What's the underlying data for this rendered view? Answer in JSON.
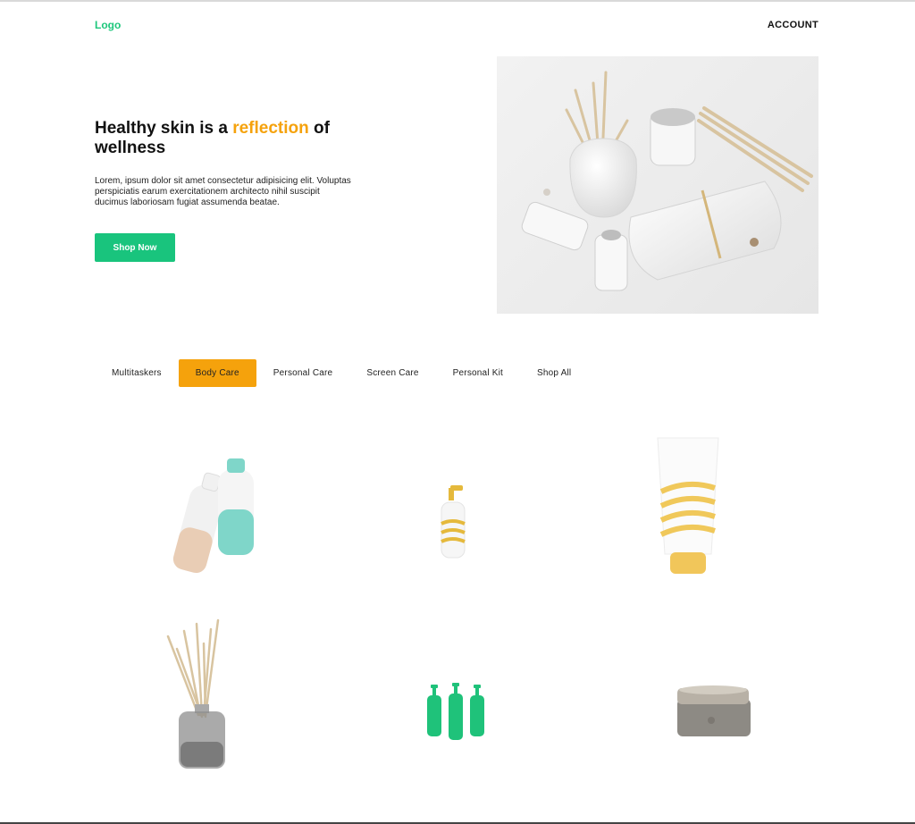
{
  "header": {
    "logo": "Logo",
    "account": "ACCOUNT"
  },
  "hero": {
    "title_before": "Healthy skin is a ",
    "title_accent": "reflection",
    "title_after": " of wellness",
    "description": "Lorem, ipsum dolor sit amet consectetur adipisicing elit. Voluptas perspiciatis earum exercitationem architecto nihil suscipit ducimus laboriosam fugiat assumenda beatae.",
    "cta_label": "Shop Now",
    "image": "spa-products-photo"
  },
  "tabs": {
    "items": [
      {
        "label": "Multitaskers"
      },
      {
        "label": "Body Care"
      },
      {
        "label": "Personal Care"
      },
      {
        "label": "Screen Care"
      },
      {
        "label": "Personal Kit"
      },
      {
        "label": "Shop All"
      }
    ],
    "active_index": 1
  },
  "products": [
    {
      "image": "two-bottles-product"
    },
    {
      "image": "pump-bottle-product"
    },
    {
      "image": "yellow-tube-product"
    },
    {
      "image": "reed-diffuser-product"
    },
    {
      "image": "green-pump-bottles-product"
    },
    {
      "image": "metal-jar-product"
    }
  ],
  "colors": {
    "brand_green": "#19c47d",
    "accent_orange": "#f5a20c",
    "text_dark": "#111111"
  }
}
